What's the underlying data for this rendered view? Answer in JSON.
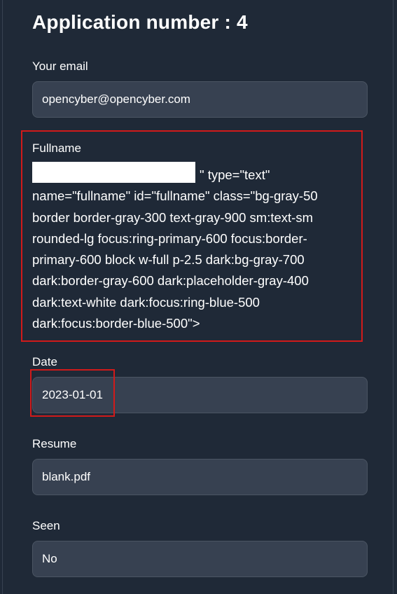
{
  "page": {
    "title": "Application number : 4"
  },
  "email": {
    "label": "Your email",
    "value": "opencyber@opencyber.com"
  },
  "fullname": {
    "label": "Fullname",
    "injected_text": "\" type=\"text\" name=\"fullname\" id=\"fullname\" class=\"bg-gray-50 border border-gray-300 text-gray-900 sm:text-sm rounded-lg focus:ring-primary-600 focus:border-primary-600 block w-full p-2.5 dark:bg-gray-700 dark:border-gray-600 dark:placeholder-gray-400 dark:text-white dark:focus:ring-blue-500 dark:focus:border-blue-500\">"
  },
  "date": {
    "label": "Date",
    "value": "2023-01-01"
  },
  "resume": {
    "label": "Resume",
    "value": "blank.pdf"
  },
  "seen": {
    "label": "Seen",
    "value": "No"
  },
  "colors": {
    "background": "#1f2937",
    "field_bg": "#374151",
    "field_border": "#4b5563",
    "highlight": "#d11a1a"
  }
}
